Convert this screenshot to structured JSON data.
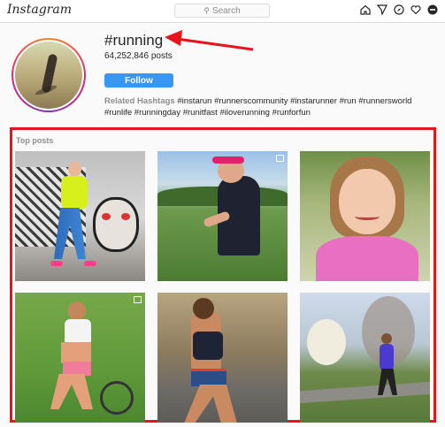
{
  "topbar": {
    "logo": "Instagram",
    "search_placeholder": "Search",
    "icons": [
      "home-icon",
      "direct-icon",
      "explore-icon",
      "activity-icon",
      "profile-icon"
    ]
  },
  "hashtag": {
    "title": "#running",
    "post_count": "64,252,846 posts",
    "follow_label": "Follow",
    "related_label": "Related Hashtags",
    "related_tags": "#instarun #runnerscommunity #instarunner #run #runnersworld #runlife #runningday #runitfast #iloverunning #runforfun"
  },
  "top_posts": {
    "label": "Top posts"
  },
  "colors": {
    "accent": "#3897f0",
    "highlight": "#e8141b"
  }
}
